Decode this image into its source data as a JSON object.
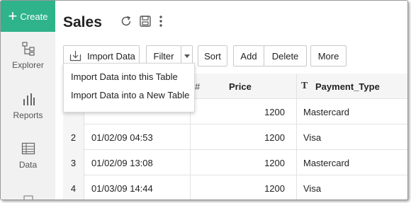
{
  "sidebar": {
    "create_label": "Create",
    "items": [
      {
        "label": "Explorer",
        "icon": "explorer-icon"
      },
      {
        "label": "Reports",
        "icon": "reports-icon"
      },
      {
        "label": "Data",
        "icon": "data-icon"
      }
    ]
  },
  "header": {
    "title": "Sales",
    "icons": [
      "refresh-icon",
      "save-icon",
      "more-vertical-icon"
    ]
  },
  "toolbar": {
    "import_label": "Import Data",
    "filter_label": "Filter",
    "sort_label": "Sort",
    "add_label": "Add",
    "delete_label": "Delete",
    "more_label": "More"
  },
  "import_menu": {
    "items": [
      "Import Data into this Table",
      "Import Data into a New Table"
    ]
  },
  "table": {
    "columns": [
      {
        "type_glyph": "#",
        "label": "Price"
      },
      {
        "type_glyph": "T",
        "label": "Payment_Type"
      }
    ],
    "rows": [
      {
        "num": "",
        "date": "",
        "price": "1200",
        "payment": "Mastercard"
      },
      {
        "num": "2",
        "date": "01/02/09 04:53",
        "price": "1200",
        "payment": "Visa"
      },
      {
        "num": "3",
        "date": "01/02/09 13:08",
        "price": "1200",
        "payment": "Mastercard"
      },
      {
        "num": "4",
        "date": "01/03/09 14:44",
        "price": "1200",
        "payment": "Visa"
      }
    ]
  },
  "colors": {
    "accent": "#2fb38a",
    "sidebar_bg": "#f1f1f1"
  }
}
